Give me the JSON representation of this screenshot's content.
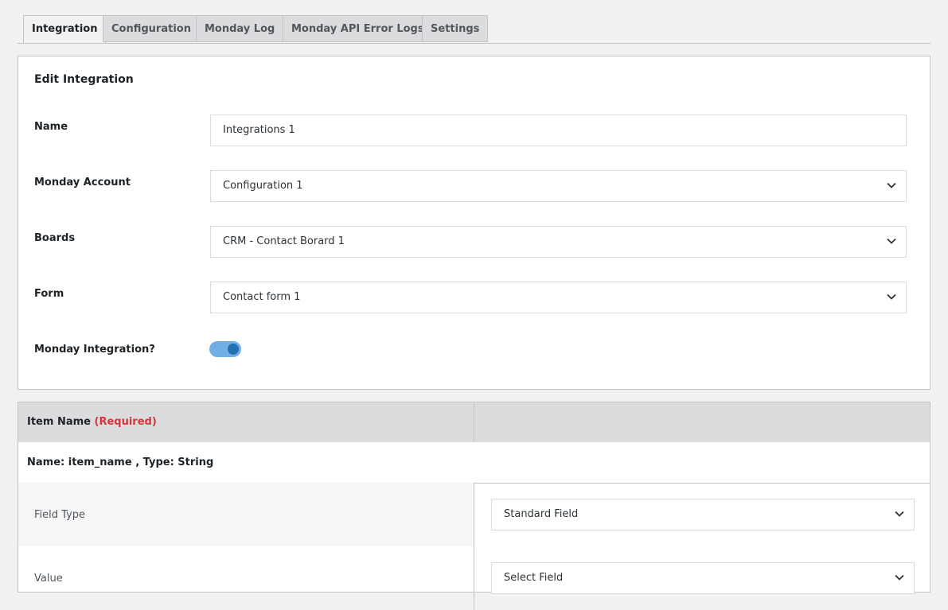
{
  "tabs": [
    "Integration",
    "Configuration",
    "Monday Log",
    "Monday API Error Logs",
    "Settings"
  ],
  "active_tab": "Integration",
  "edit": {
    "title": "Edit Integration",
    "name_label": "Name",
    "name_value": "Integrations 1",
    "account_label": "Monday Account",
    "account_value": "Configuration 1",
    "boards_label": "Boards",
    "boards_value": "CRM - Contact Borard 1",
    "form_label": "Form",
    "form_value": "Contact form 1",
    "integration_label": "Monday Integration?",
    "integration_enabled": true
  },
  "table": {
    "header_label": "Item Name",
    "header_required": "(Required)",
    "subheader": "Name: item_name , Type: String",
    "field_type_label": "Field Type",
    "field_type_value": "Standard Field",
    "value_label": "Value",
    "value_value": "Select Field"
  },
  "colors": {
    "toggle_track": "#72aee6",
    "toggle_knob": "#2271b1",
    "required": "#d63638"
  }
}
